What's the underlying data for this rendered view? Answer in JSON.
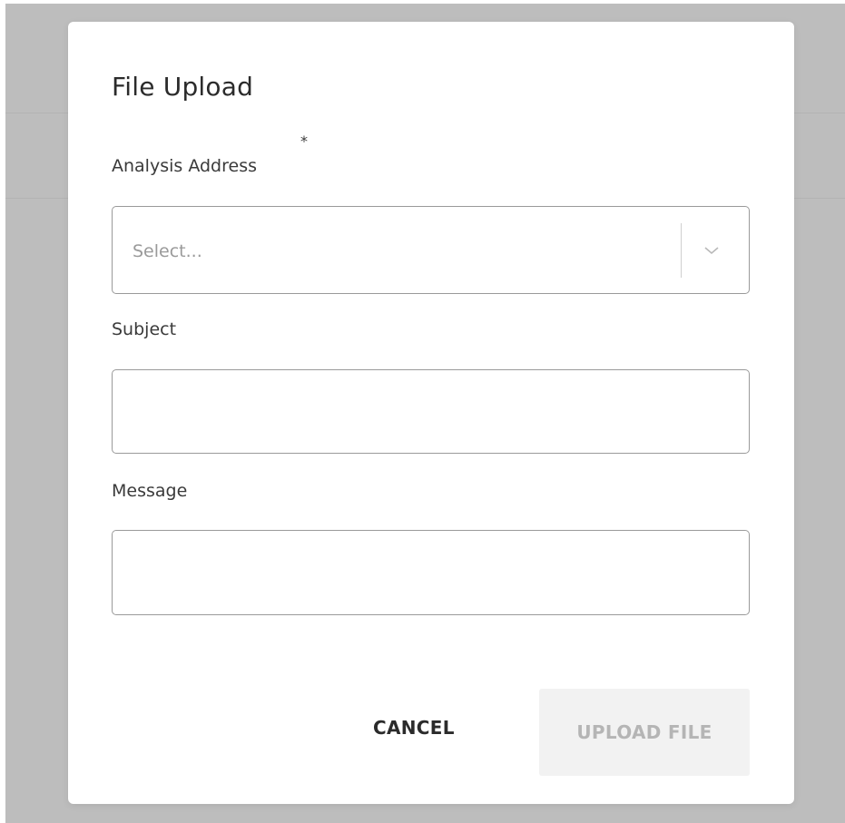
{
  "dialog": {
    "title": "File Upload",
    "fields": {
      "analysis_address": {
        "label": "Analysis Address",
        "required_marker": "*",
        "placeholder": "Select..."
      },
      "subject": {
        "label": "Subject",
        "value": ""
      },
      "message": {
        "label": "Message",
        "value": ""
      }
    },
    "buttons": {
      "cancel": "CANCEL",
      "upload": "UPLOAD FILE"
    }
  },
  "colors": {
    "backdrop": "#bdbdbd",
    "modal_background": "#ffffff",
    "text_primary": "#2b2b2b",
    "placeholder": "#9a9a9a",
    "disabled_button_background": "#f2f2f2",
    "disabled_button_text": "#b5b5b5"
  },
  "icons": {
    "select_indicator": "chevron-down-icon"
  }
}
